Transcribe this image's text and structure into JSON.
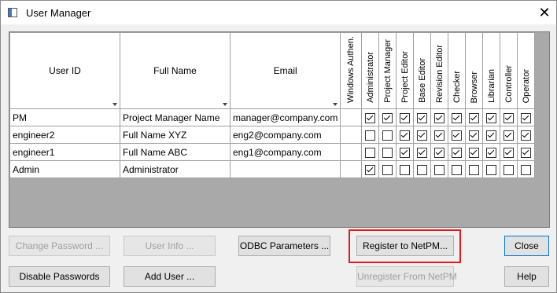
{
  "window": {
    "title": "User Manager",
    "close_glyph": "✕"
  },
  "grid": {
    "columns": [
      "User ID",
      "Full Name",
      "Email",
      "Windows Authen.",
      "Administrator",
      "Project Manager",
      "Project Editor",
      "Base Editor",
      "Revision Editor",
      "Checker",
      "Browser",
      "Librarian",
      "Controller",
      "Operator"
    ],
    "rows": [
      {
        "user_id": "PM",
        "full_name": "Project Manager Name",
        "email": "manager@company.com",
        "windows": "",
        "roles": [
          true,
          true,
          true,
          true,
          true,
          true,
          true,
          true,
          true,
          true
        ]
      },
      {
        "user_id": "engineer2",
        "full_name": "Full Name XYZ",
        "email": "eng2@company.com",
        "windows": "",
        "roles": [
          false,
          false,
          true,
          true,
          true,
          true,
          true,
          true,
          true,
          true
        ]
      },
      {
        "user_id": "engineer1",
        "full_name": "Full Name ABC",
        "email": "eng1@company.com",
        "windows": "",
        "roles": [
          false,
          false,
          true,
          true,
          true,
          true,
          true,
          true,
          true,
          true
        ]
      },
      {
        "user_id": "Admin",
        "full_name": "Administrator",
        "email": "",
        "windows": "",
        "roles": [
          true,
          false,
          false,
          false,
          false,
          false,
          false,
          false,
          false,
          false
        ]
      }
    ]
  },
  "buttons": {
    "change_password": "Change Password ...",
    "user_info": "User Info ...",
    "odbc": "ODBC Parameters ...",
    "register": "Register to NetPM...",
    "close": "Close",
    "disable_passwords": "Disable Passwords",
    "add_user": "Add User ...",
    "unregister": "Unregister From NetPM",
    "help": "Help"
  },
  "colors": {
    "highlight": "#e11b1b",
    "grid_background": "#a9a9a9"
  }
}
